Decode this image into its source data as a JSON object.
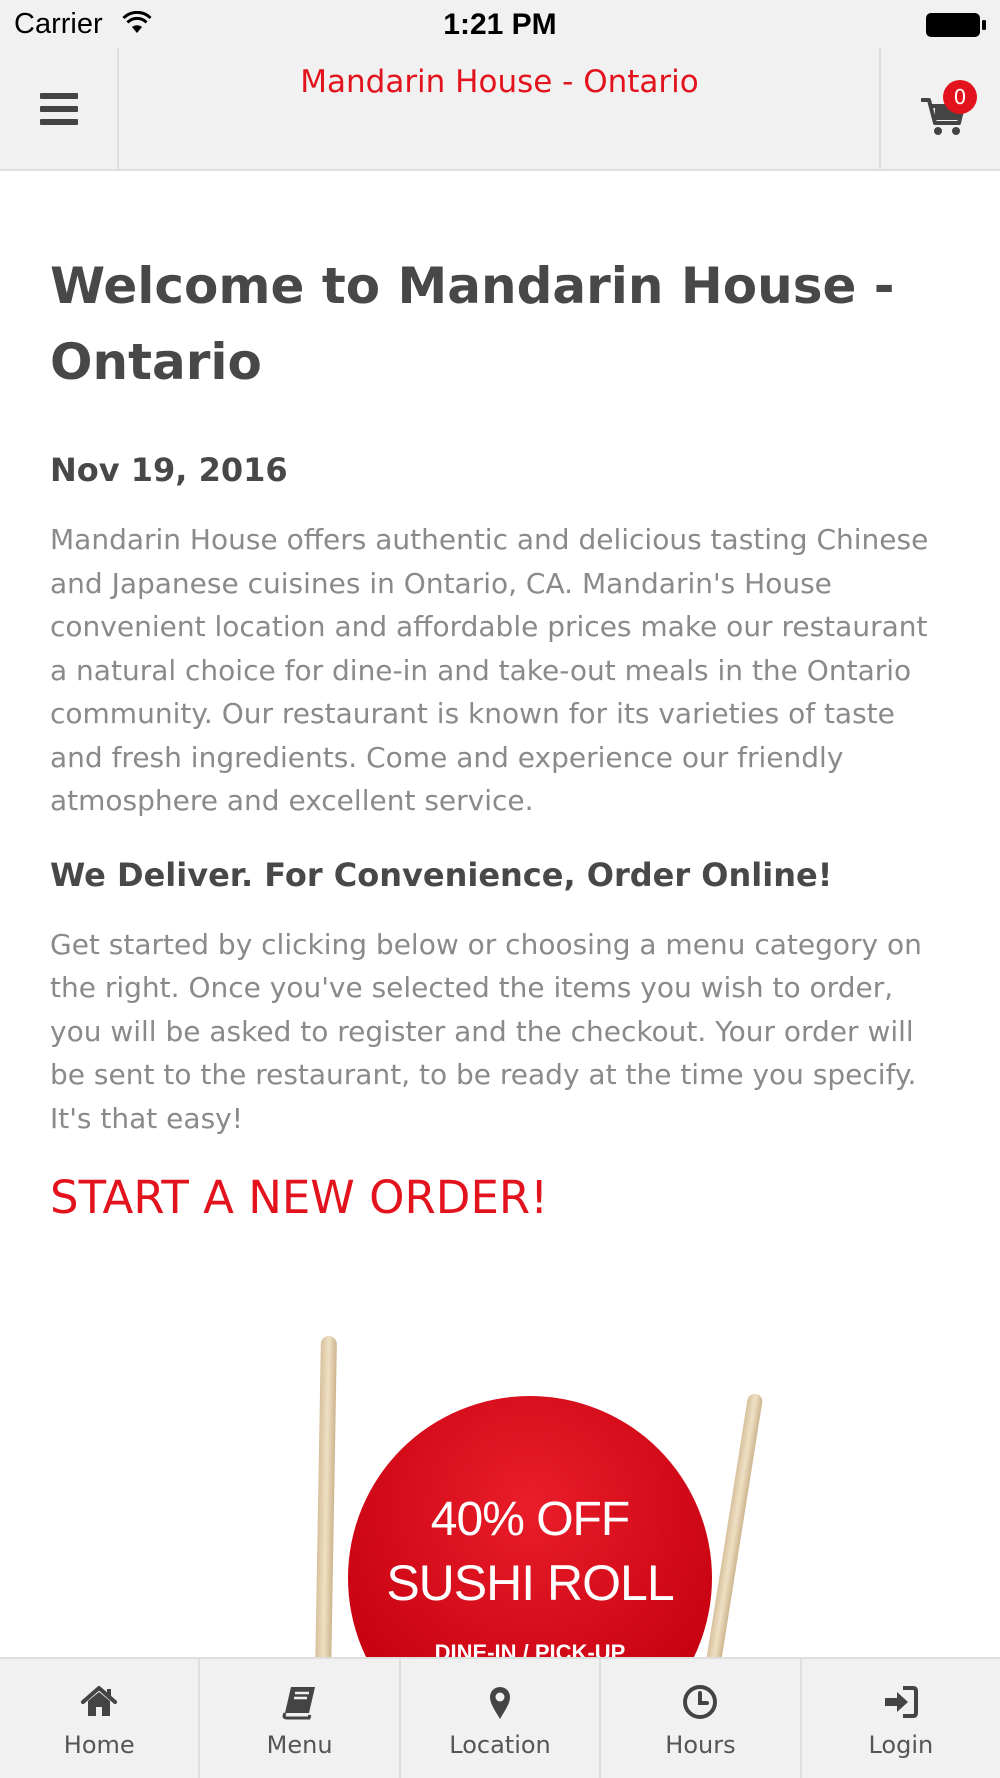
{
  "status_bar": {
    "carrier": "Carrier",
    "time": "1:21 PM"
  },
  "header": {
    "title": "Mandarin House - Ontario",
    "cart_count": "0"
  },
  "content": {
    "title": "Welcome to Mandarin House - Ontario",
    "date": "Nov 19, 2016",
    "intro": "Mandarin House offers authentic and delicious tasting Chinese and Japanese cuisines in Ontario, CA. Mandarin's House convenient location and affordable prices make our restaurant a natural choice for dine-in and take-out meals in the Ontario community. Our restaurant is known for its varieties of taste and fresh ingredients. Come and experience our friendly atmosphere and excellent service.",
    "subheading": "We Deliver. For Convenience, Order Online!",
    "instructions": "Get started by clicking below or choosing a menu category on the right. Once you've selected the items you wish to order, you will be asked to register and the checkout. Your order will be sent to the restaurant, to be ready at the time you specify. It's that easy!",
    "cta": "START A NEW ORDER!"
  },
  "promo": {
    "line1": "40% OFF",
    "line2": "SUSHI ROLL",
    "line3": "DINE-IN / PICK-UP"
  },
  "tabbar": {
    "tabs": [
      {
        "label": "Home",
        "icon": "home-icon"
      },
      {
        "label": "Menu",
        "icon": "book-icon"
      },
      {
        "label": "Location",
        "icon": "map-pin-icon"
      },
      {
        "label": "Hours",
        "icon": "clock-icon"
      },
      {
        "label": "Login",
        "icon": "sign-in-icon"
      }
    ]
  },
  "colors": {
    "accent": "#e2131d",
    "bar_background": "#f1f1f1",
    "heading": "#484848",
    "body_text": "#8a8a8a"
  }
}
